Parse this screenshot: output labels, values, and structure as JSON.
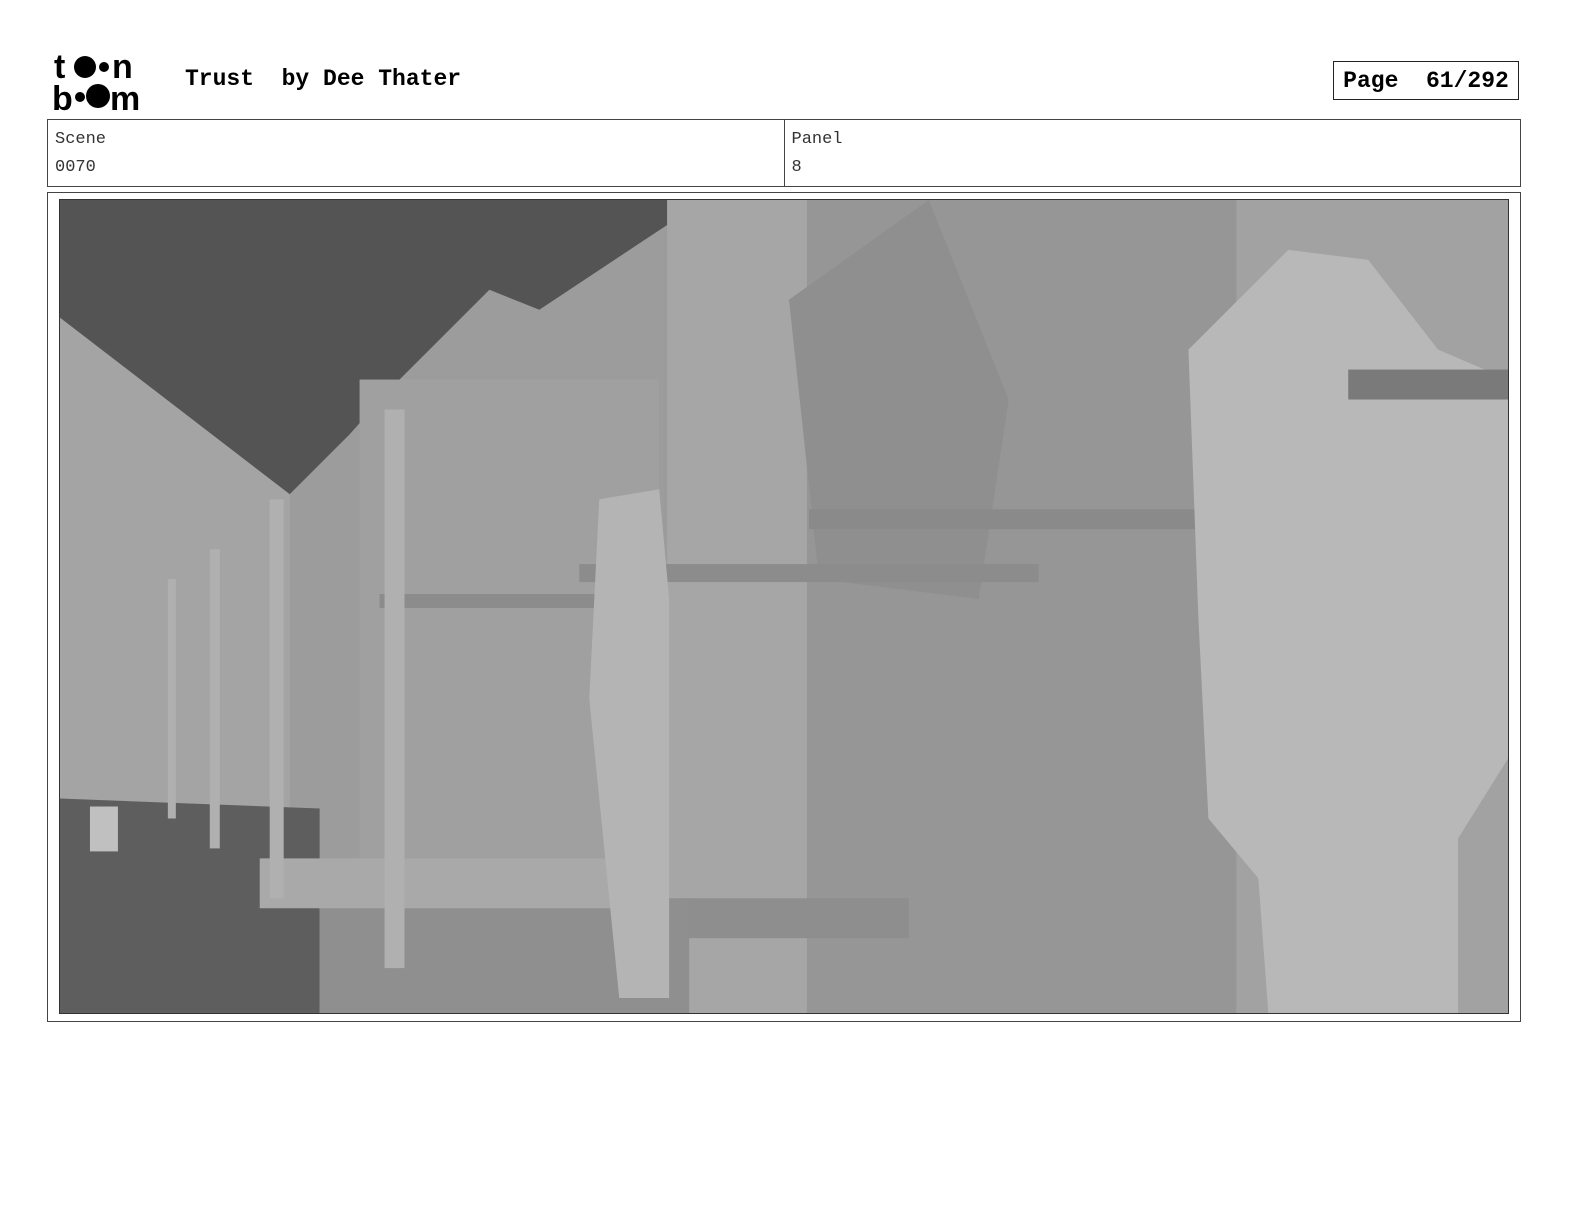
{
  "header": {
    "logo_text": "toon boom",
    "title": "Trust  by Dee Thater",
    "page_label": "Page",
    "page_value": "61/292"
  },
  "info": {
    "scene_label": "Scene",
    "scene_value": "0070",
    "panel_label": "Panel",
    "panel_value": "8"
  },
  "panel_image": {
    "description_icon": "storyboard-render-image"
  }
}
